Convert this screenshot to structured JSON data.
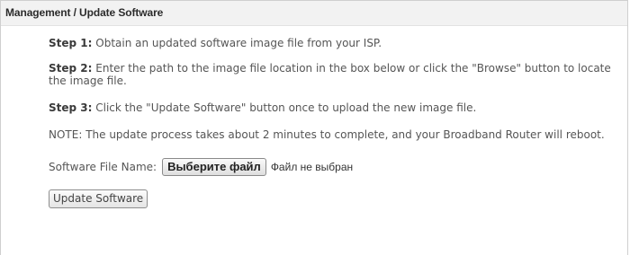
{
  "header": {
    "title": "Management / Update Software"
  },
  "steps": [
    {
      "label": "Step 1:",
      "text": " Obtain an updated software image file from your ISP."
    },
    {
      "label": "Step 2:",
      "text": " Enter the path to the image file location in the box below or click the \"Browse\" button to locate the image file."
    },
    {
      "label": "Step 3:",
      "text": " Click the \"Update Software\" button once to upload the new image file."
    }
  ],
  "note": "NOTE: The update process takes about 2 minutes to complete, and your Broadband Router will reboot.",
  "file_input": {
    "label": "Software File Name:",
    "button_label": "Выберите файл",
    "status": "Файл не выбран"
  },
  "update_button": {
    "label": "Update Software"
  }
}
